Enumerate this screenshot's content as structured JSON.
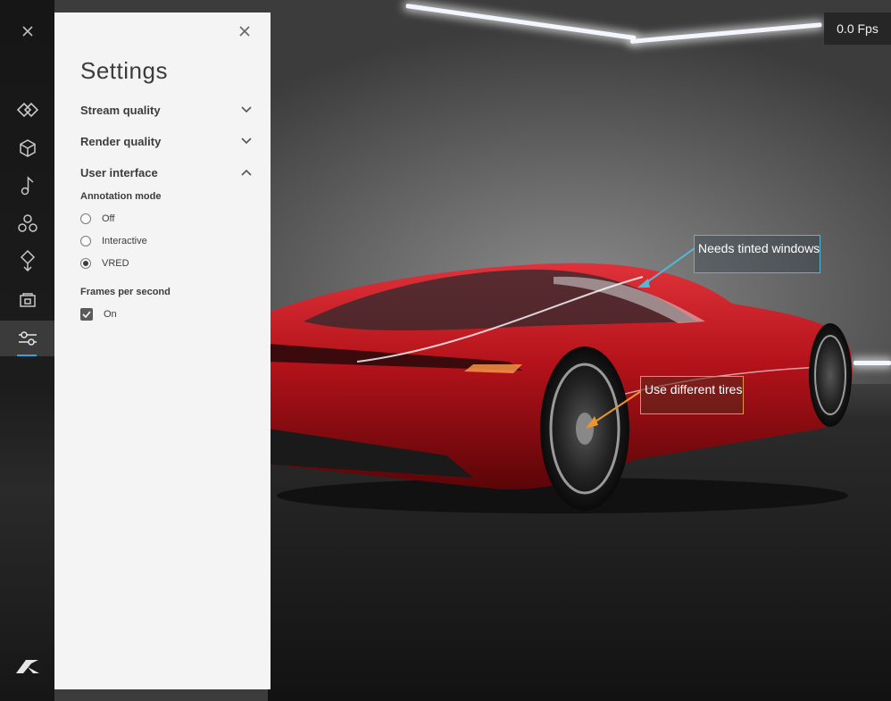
{
  "viewport": {
    "fps_label": "0.0 Fps",
    "annotations": [
      {
        "text": "Needs tinted windows",
        "color": "#52b8d6"
      },
      {
        "text": "Use different tires",
        "color": "#e8962d"
      }
    ],
    "car_color": "#c0141c"
  },
  "rail": {
    "items": [
      {
        "icon": "close-icon"
      },
      {
        "icon": "views-icon"
      },
      {
        "icon": "cube-icon"
      },
      {
        "icon": "music-note-icon"
      },
      {
        "icon": "variant-sets-icon"
      },
      {
        "icon": "diamond-pin-icon"
      },
      {
        "icon": "camera-frame-icon"
      },
      {
        "icon": "settings-sliders-icon",
        "active": true
      },
      {
        "icon": "autodesk-logo-icon"
      }
    ],
    "active_color": "#29a5e0"
  },
  "settings": {
    "title": "Settings",
    "sections": [
      {
        "label": "Stream quality",
        "expanded": false
      },
      {
        "label": "Render quality",
        "expanded": false
      },
      {
        "label": "User interface",
        "expanded": true
      }
    ],
    "annotation_mode": {
      "label": "Annotation mode",
      "options": [
        "Off",
        "Interactive",
        "VRED"
      ],
      "selected": "VRED"
    },
    "frames_per_second": {
      "label": "Frames per second",
      "checkbox_label": "On",
      "checked": true
    }
  }
}
